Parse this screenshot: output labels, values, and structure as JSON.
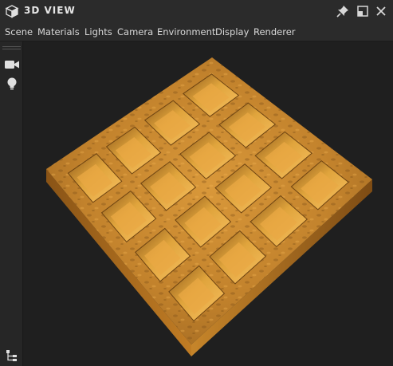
{
  "window": {
    "title": "3D VIEW",
    "icons": {
      "app": "cube-icon",
      "pin": "pin-icon",
      "maximize": "maximize-icon",
      "close": "close-icon"
    }
  },
  "menubar": {
    "items": [
      "Scene",
      "Materials",
      "Lights",
      "Camera",
      "Environment",
      "Display",
      "Renderer"
    ]
  },
  "toolstrip": {
    "icons": [
      "camera-icon",
      "lightbulb-icon",
      "scene-tree-icon"
    ]
  },
  "viewport": {
    "object": "waffle",
    "grid": {
      "rows": 4,
      "cols": 4
    },
    "colors": {
      "background": "#1f1f1f",
      "waffle_top": "#c98a2e",
      "waffle_dark": "#8a5a1c",
      "waffle_side": "#a9661a",
      "waffle_light": "#f2b24a"
    }
  }
}
